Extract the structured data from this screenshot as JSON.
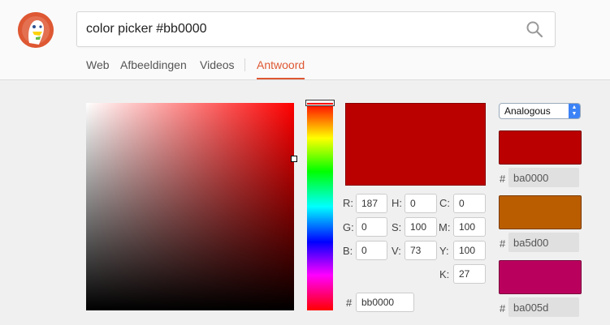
{
  "search": {
    "query": "color picker #bb0000"
  },
  "tabs": [
    {
      "label": "Web"
    },
    {
      "label": "Afbeeldingen"
    },
    {
      "label": "Videos"
    },
    {
      "label": "Antwoord"
    }
  ],
  "picker": {
    "selected_color": "#bb0000",
    "hue": 0,
    "saturation": 100,
    "value": 73,
    "rgb": {
      "r_label": "R:",
      "r": "187",
      "g_label": "G:",
      "g": "0",
      "b_label": "B:",
      "b": "0"
    },
    "hsv": {
      "h_label": "H:",
      "h": "0",
      "s_label": "S:",
      "s": "100",
      "v_label": "V:",
      "v": "73"
    },
    "cmyk": {
      "c_label": "C:",
      "c": "0",
      "m_label": "M:",
      "m": "100",
      "y_label": "Y:",
      "y": "100",
      "k_label": "K:",
      "k": "27"
    },
    "hex_label": "#",
    "hex": "bb0000"
  },
  "scheme": {
    "selected": "Analogous",
    "swatches": [
      {
        "color": "#ba0000",
        "hash": "#",
        "hex": "ba0000"
      },
      {
        "color": "#ba5d00",
        "hash": "#",
        "hex": "ba5d00"
      },
      {
        "color": "#ba005d",
        "hash": "#",
        "hex": "ba005d"
      }
    ]
  },
  "icons": {
    "logo": "duckduckgo-logo",
    "search": "magnifier-icon",
    "select": "up-down-arrows-icon"
  }
}
